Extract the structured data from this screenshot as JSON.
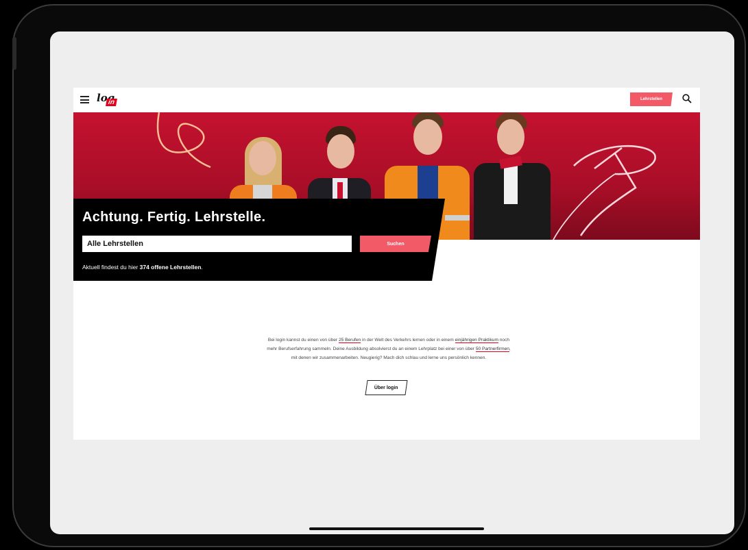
{
  "header": {
    "logo_top": "log",
    "logo_bottom": "in",
    "lehrstellen_label": "Lehrstellen",
    "icons": [
      "menu-icon",
      "search-icon"
    ]
  },
  "hero": {
    "headline": "Achtung. Fertig. Lehrstelle.",
    "select_value": "Alle Lehrstellen",
    "search_label": "Suchen",
    "count_prefix": "Aktuell findest du hier ",
    "count_bold": "374 offene Lehrstellen",
    "count_suffix": "."
  },
  "intro": {
    "t1": "Bei login kannst du einen von über ",
    "l1": "25 Berufen",
    "t2": " in der Welt des Verkehrs lernen oder in einem ",
    "l2": "einjährigen Praktikum",
    "t3": " noch mehr Berufserfahrung sammeln. Deine Ausbildung absolvierst du an einem Lehrplatz bei einer von über ",
    "l3": "50 Partnerfirmen",
    "t4": ", mit denen wir zusammenarbeiten. Neugierig? Mach dich schlau und lerne uns persönlich kennen.",
    "button_label": "Über login"
  },
  "colors": {
    "brand_red": "#e2001a",
    "button_pink": "#f35a68",
    "hero_red": "#c41230"
  }
}
